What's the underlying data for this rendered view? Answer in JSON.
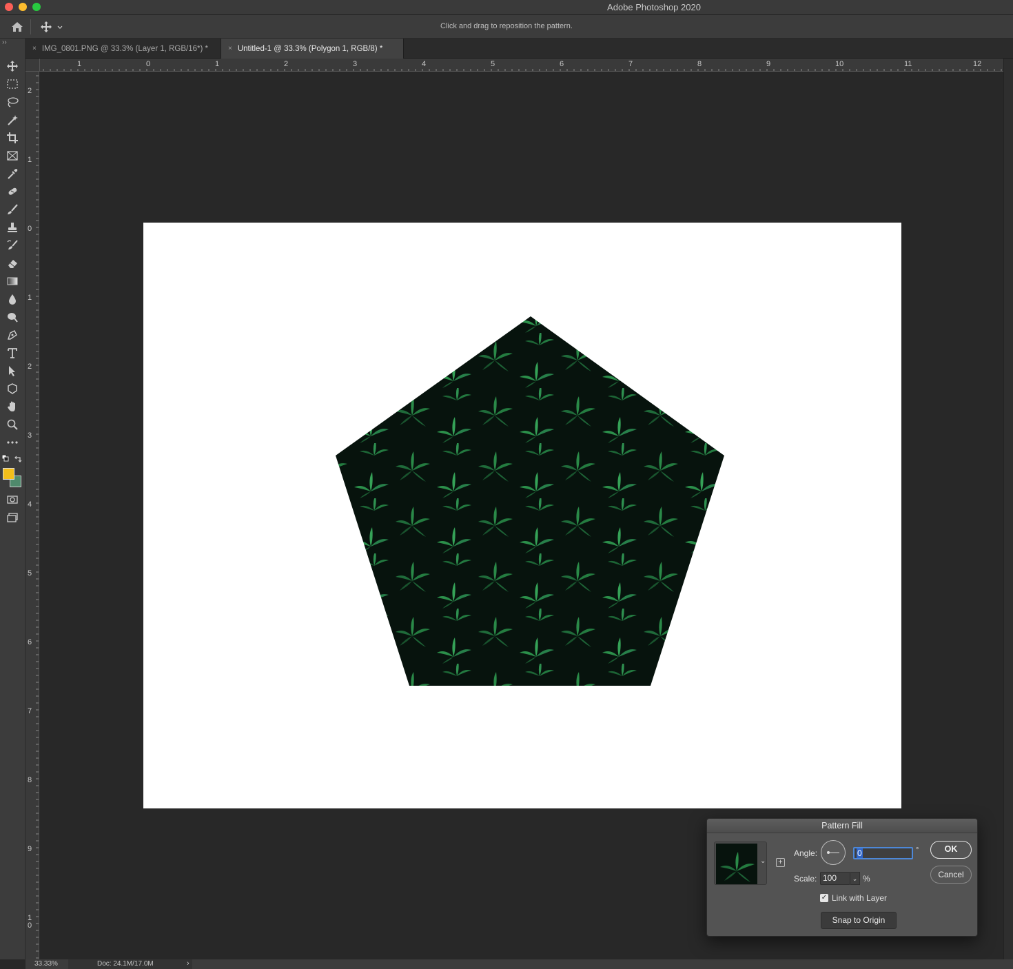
{
  "window": {
    "title": "Adobe Photoshop 2020"
  },
  "options_bar": {
    "hint": "Click and drag to reposition the pattern."
  },
  "tabs": [
    {
      "label": "IMG_0801.PNG @ 33.3% (Layer 1, RGB/16*) *",
      "close": "×",
      "active": false
    },
    {
      "label": "Untitled-1 @ 33.3% (Polygon 1, RGB/8) *",
      "close": "×",
      "active": true
    }
  ],
  "rulers": {
    "horizontal": [
      "1",
      "0",
      "1",
      "2",
      "3",
      "4",
      "5",
      "6",
      "7",
      "8",
      "9",
      "10",
      "11",
      "12"
    ],
    "vertical": [
      "2",
      "1",
      "0",
      "1",
      "2",
      "3",
      "4",
      "5",
      "6",
      "7",
      "8",
      "9",
      "1\n0"
    ]
  },
  "tools": [
    {
      "icon": "move-icon"
    },
    {
      "icon": "marquee-icon"
    },
    {
      "icon": "lasso-icon"
    },
    {
      "icon": "magic-wand-icon"
    },
    {
      "icon": "crop-icon"
    },
    {
      "icon": "frame-icon"
    },
    {
      "icon": "eyedropper-icon"
    },
    {
      "icon": "healing-brush-icon"
    },
    {
      "icon": "brush-icon"
    },
    {
      "icon": "clone-stamp-icon"
    },
    {
      "icon": "history-brush-icon"
    },
    {
      "icon": "eraser-icon"
    },
    {
      "icon": "gradient-icon"
    },
    {
      "icon": "blur-icon"
    },
    {
      "icon": "dodge-icon"
    },
    {
      "icon": "pen-icon"
    },
    {
      "icon": "type-icon"
    },
    {
      "icon": "path-selection-icon"
    },
    {
      "icon": "shape-icon"
    },
    {
      "icon": "hand-icon"
    },
    {
      "icon": "zoom-icon"
    },
    {
      "icon": "more-tools-icon"
    }
  ],
  "colors": {
    "foreground": "#f2be1a",
    "background": "#4f8a6c",
    "accent": "#4d88d8"
  },
  "status": {
    "zoom": "33.33%",
    "doc": "Doc: 24.1M/17.0M",
    "arrow": "›"
  },
  "dialog": {
    "title": "Pattern Fill",
    "angle_label": "Angle:",
    "angle_value": "0",
    "degree_symbol": "°",
    "scale_label": "Scale:",
    "scale_value": "100",
    "percent": "%",
    "link_with_layer_label": "Link with Layer",
    "link_with_layer_checked": true,
    "snap_label": "Snap to Origin",
    "ok_label": "OK",
    "cancel_label": "Cancel"
  }
}
